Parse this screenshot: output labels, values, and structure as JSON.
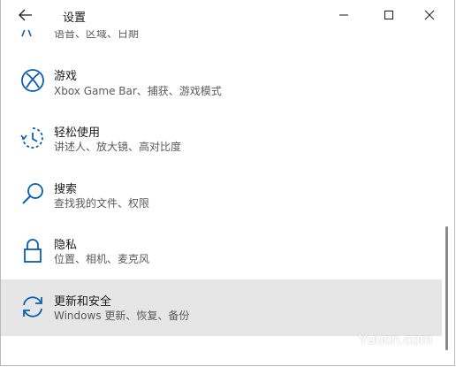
{
  "window": {
    "title": "设置"
  },
  "partial_item": {
    "desc": "语音、区域、日期"
  },
  "items": [
    {
      "label": "游戏",
      "desc": "Xbox Game Bar、捕获、游戏模式",
      "icon": "xbox-icon"
    },
    {
      "label": "轻松使用",
      "desc": "讲述人、放大镜、高对比度",
      "icon": "ease-of-access-icon"
    },
    {
      "label": "搜索",
      "desc": "查找我的文件、权限",
      "icon": "search-icon"
    },
    {
      "label": "隐私",
      "desc": "位置、相机、麦克风",
      "icon": "lock-icon"
    },
    {
      "label": "更新和安全",
      "desc": "Windows 更新、恢复、备份",
      "icon": "sync-icon",
      "selected": true
    }
  ],
  "colors": {
    "accent": "#0a5fb0",
    "selected_bg": "#e6e6e6"
  },
  "watermark": "Yuucn.com"
}
